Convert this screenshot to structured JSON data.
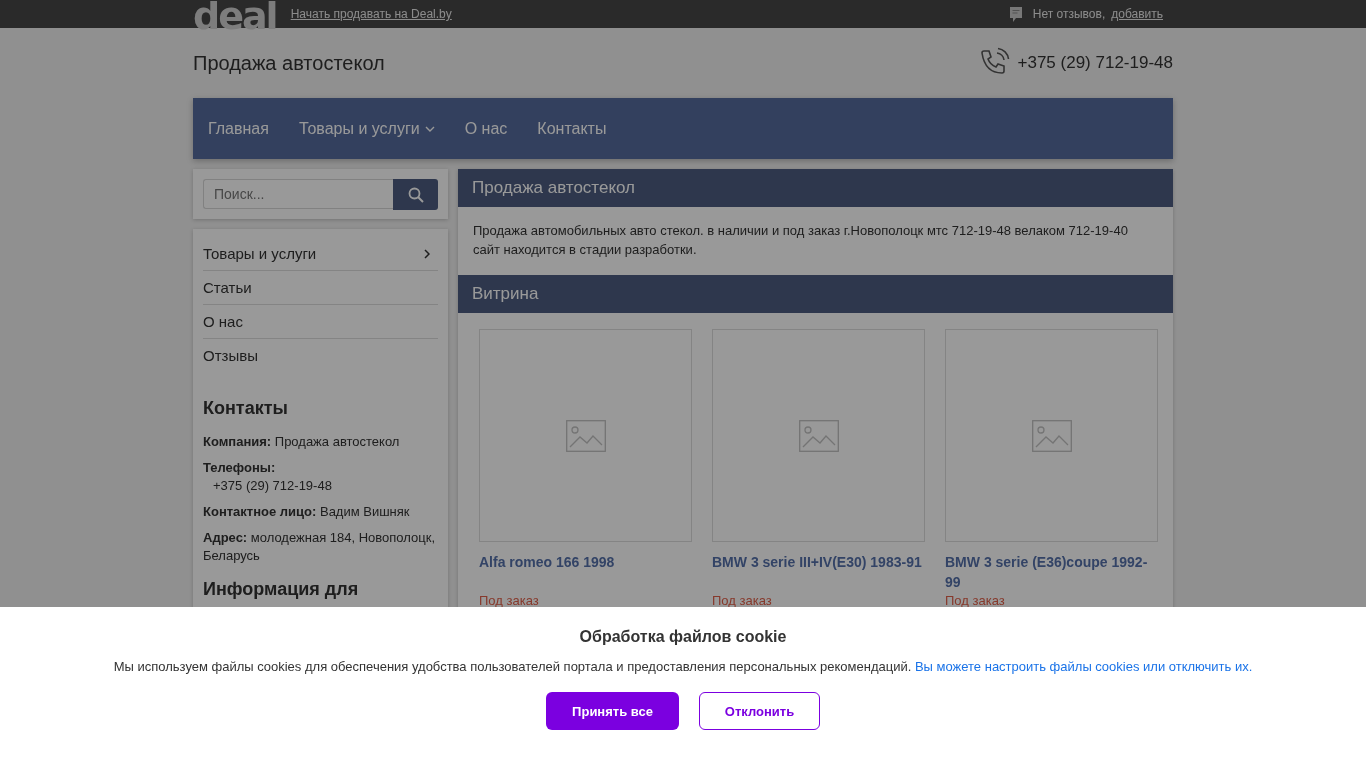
{
  "top_bar": {
    "logo": "deal",
    "sell_link": "Начать продавать на Deal.by",
    "reviews_text": "Нет отзывов,",
    "reviews_link": "добавить"
  },
  "header": {
    "title": "Продажа автостекол",
    "phone": "+375 (29) 712-19-48"
  },
  "nav": [
    {
      "label": "Главная",
      "dropdown": false
    },
    {
      "label": "Товары и услуги",
      "dropdown": true
    },
    {
      "label": "О нас",
      "dropdown": false
    },
    {
      "label": "Контакты",
      "dropdown": false
    }
  ],
  "search": {
    "placeholder": "Поиск..."
  },
  "sidebar_menu": [
    {
      "label": "Товары и услуги",
      "has_submenu": true
    },
    {
      "label": "Статьи",
      "has_submenu": false
    },
    {
      "label": "О нас",
      "has_submenu": false
    },
    {
      "label": "Отзывы",
      "has_submenu": false
    }
  ],
  "contacts": {
    "heading": "Контакты",
    "fields": [
      {
        "label": "Компания:",
        "value": "Продажа автостекол",
        "kind": "inline"
      },
      {
        "label": "Телефоны:",
        "value": "+375 (29) 712-19-48",
        "kind": "block"
      },
      {
        "label": "Контактное лицо:",
        "value": "Вадим Вишняк",
        "kind": "inline"
      },
      {
        "label": "Адрес:",
        "value": "молодежная 184, Новополоцк, Беларусь",
        "kind": "inline"
      }
    ]
  },
  "info_heading": "Информация для",
  "about": {
    "heading": "Продажа автостекол",
    "text": "Продажа автомобильных авто стекол. в наличии и под заказ г.Новополоцк мтс 712-19-48 велаком 712-19-40 сайт находится в стадии разработки."
  },
  "showcase": {
    "heading": "Витрина",
    "products": [
      {
        "name": "Alfa romeo 166 1998",
        "availability": "Под заказ"
      },
      {
        "name": "BMW 3 serie III+IV(E30) 1983-91",
        "availability": "Под заказ"
      },
      {
        "name": "BMW 3 serie (E36)coupe 1992-99",
        "availability": "Под заказ"
      }
    ]
  },
  "cookie_banner": {
    "title": "Обработка файлов cookie",
    "text": "Мы используем файлы cookies для обеспечения удобства пользователей портала и предоставления персональных рекомендаций.",
    "link": "Вы можете настроить файлы cookies или отключить их.",
    "accept": "Принять все",
    "decline": "Отклонить"
  }
}
